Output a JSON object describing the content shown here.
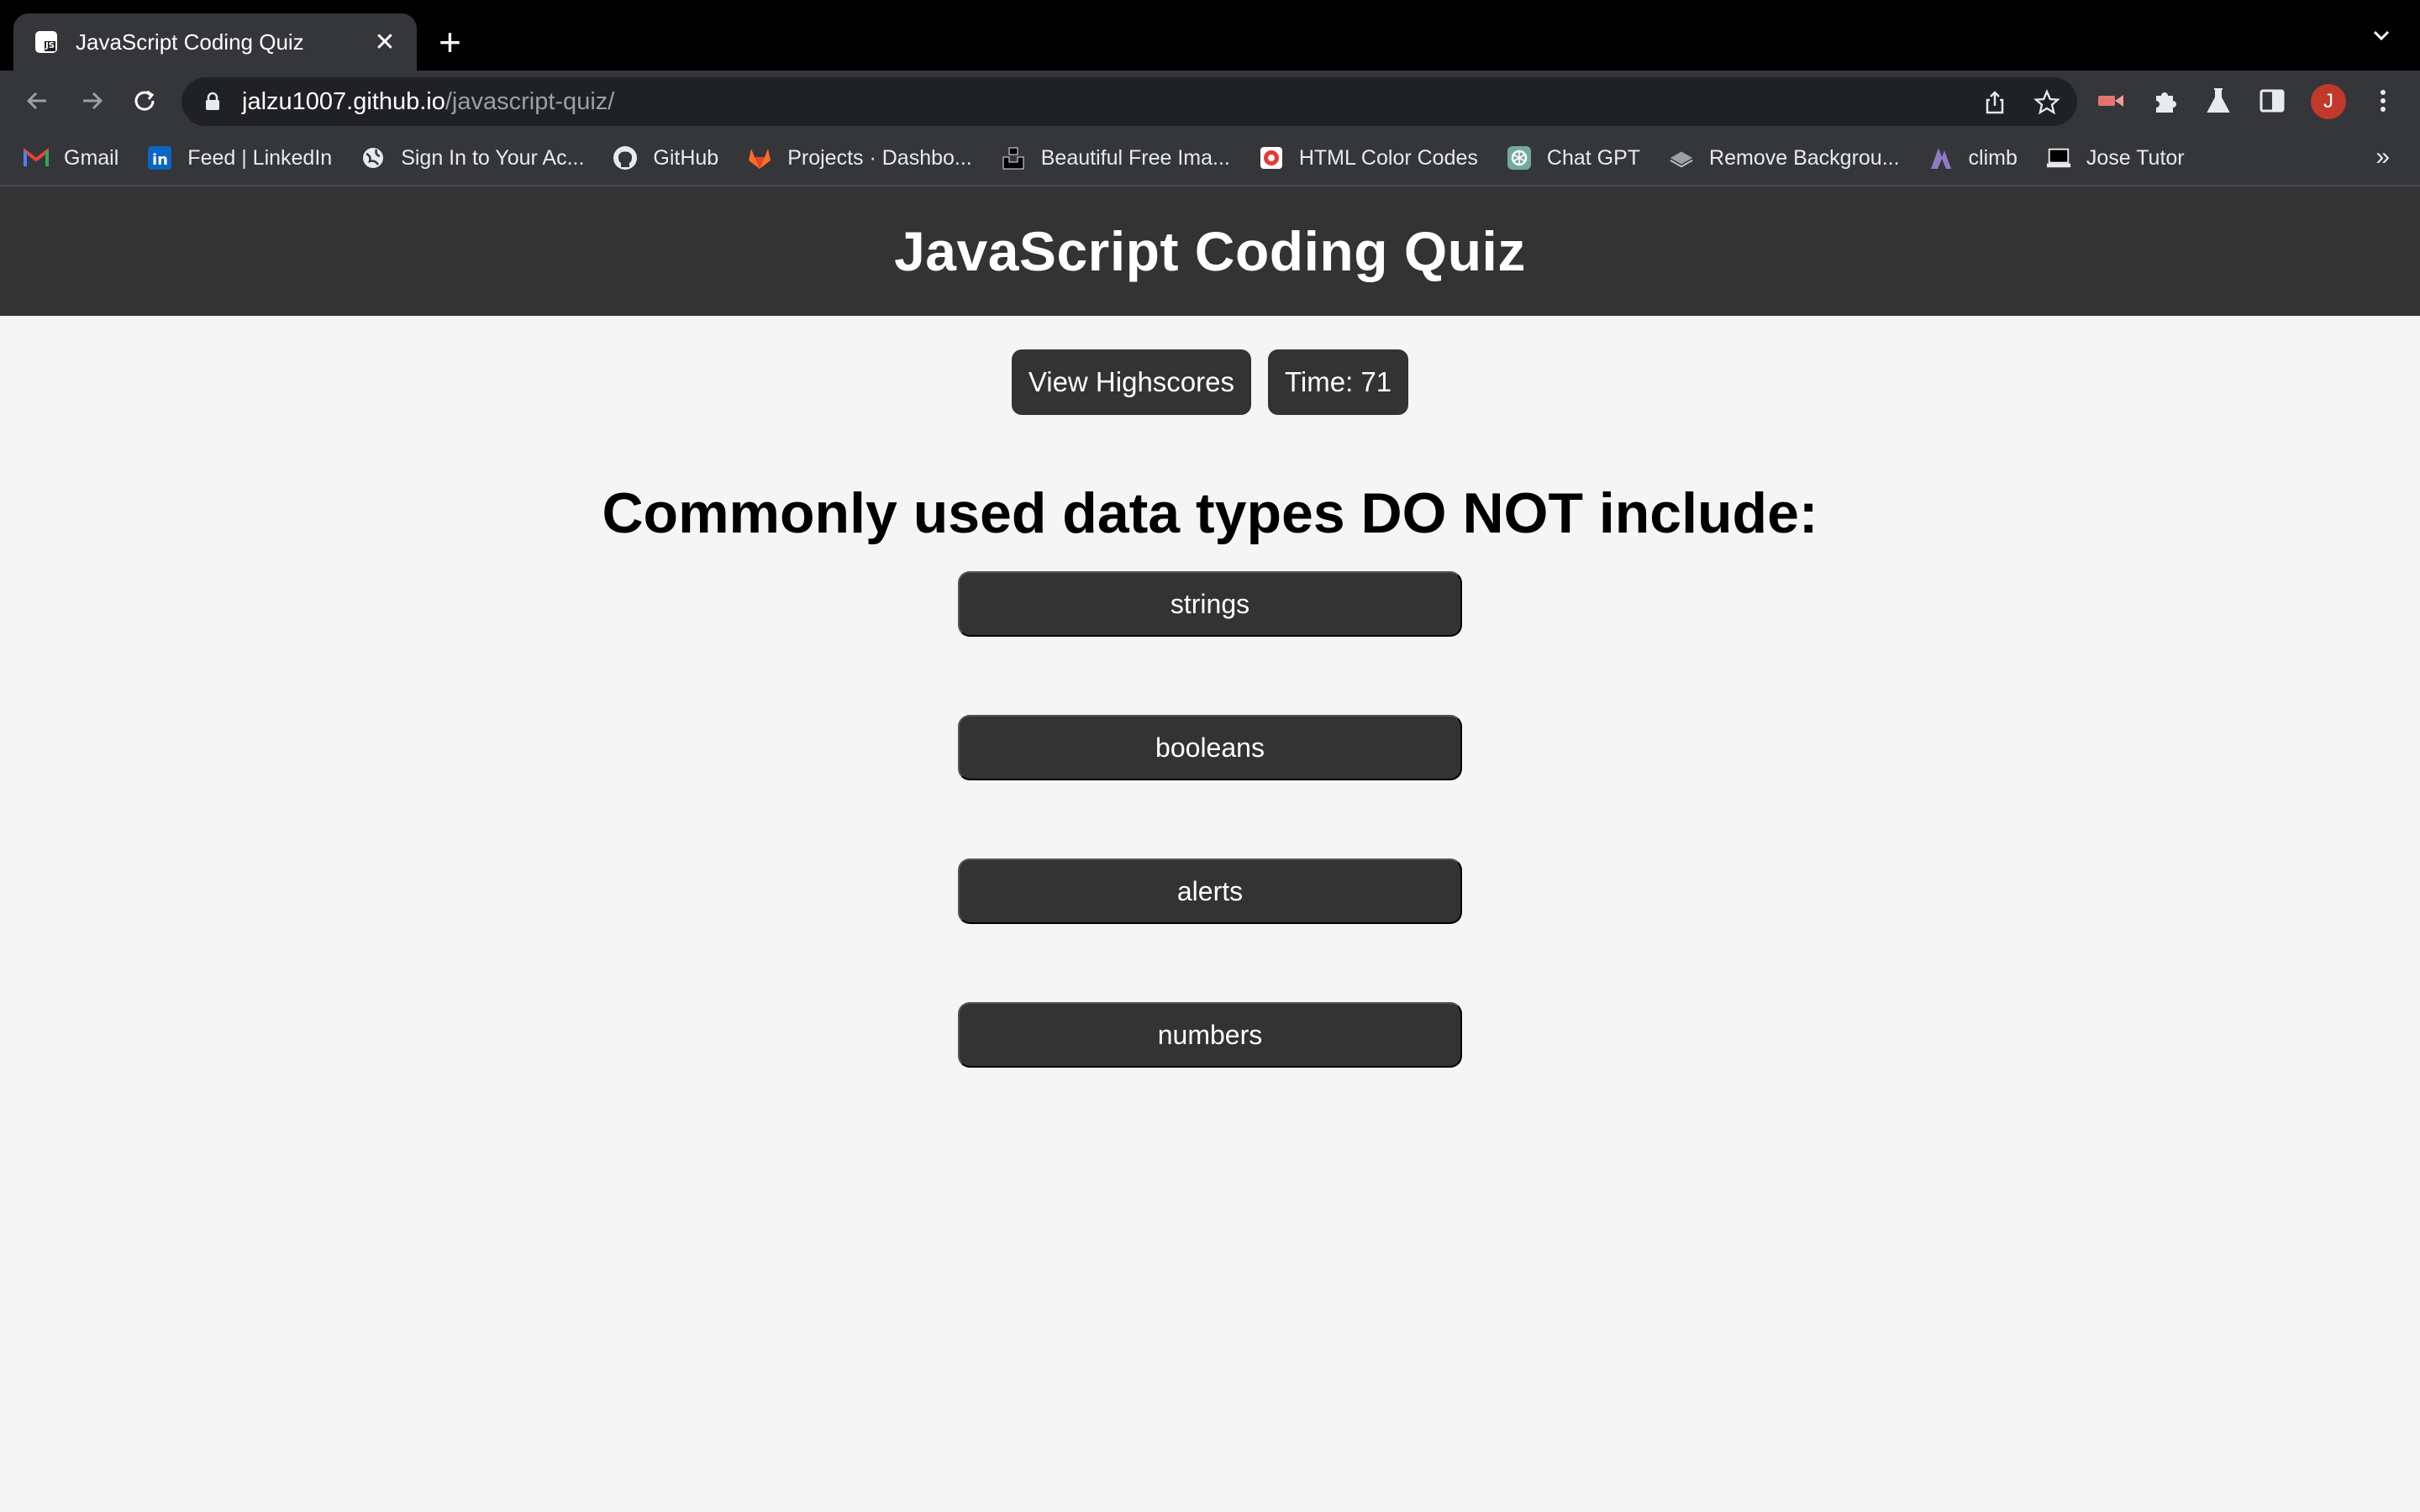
{
  "browser": {
    "tab": {
      "title": "JavaScript Coding Quiz",
      "favicon_text": "JS",
      "close_glyph": "✕"
    },
    "new_tab_glyph": "+",
    "url": {
      "host": "jalzu1007.github.io",
      "path": "/javascript-quiz/"
    },
    "profile_initial": "J",
    "bookmarks": [
      {
        "label": "Gmail",
        "icon": "gmail-icon"
      },
      {
        "label": "Feed | LinkedIn",
        "icon": "linkedin-icon"
      },
      {
        "label": "Sign In to Your Ac...",
        "icon": "globe-icon"
      },
      {
        "label": "GitHub",
        "icon": "github-icon"
      },
      {
        "label": "Projects · Dashbo...",
        "icon": "gitlab-icon"
      },
      {
        "label": "Beautiful Free Ima...",
        "icon": "unsplash-icon"
      },
      {
        "label": "HTML Color Codes",
        "icon": "color-codes-icon"
      },
      {
        "label": "Chat GPT",
        "icon": "chatgpt-icon"
      },
      {
        "label": "Remove Backgrou...",
        "icon": "remove-bg-icon"
      },
      {
        "label": "climb",
        "icon": "climb-icon"
      },
      {
        "label": "Jose Tutor",
        "icon": "laptop-icon"
      }
    ],
    "bookmarks_overflow": "»"
  },
  "page": {
    "title": "JavaScript Coding Quiz",
    "highscores_label": "View Highscores",
    "timer_label": "Time: 71",
    "question": "Commonly used data types DO NOT include:",
    "answers": [
      "strings",
      "booleans",
      "alerts",
      "numbers"
    ]
  },
  "colors": {
    "header_bg": "#333333",
    "page_bg": "#f5f5f5",
    "button_bg": "#333333",
    "button_text": "#ffffff"
  }
}
